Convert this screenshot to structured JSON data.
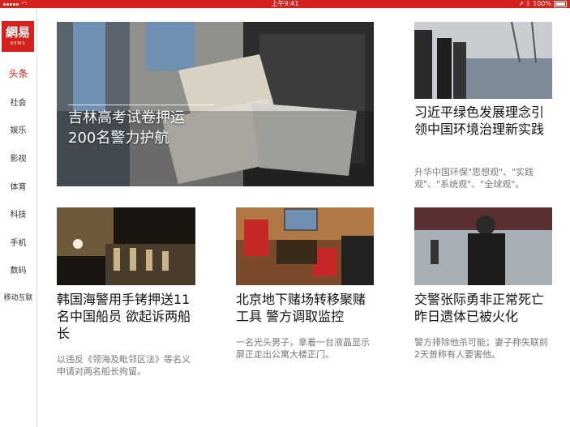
{
  "status": {
    "time": "上午9:41",
    "battery": "100%"
  },
  "logo": {
    "cn": "網易",
    "en": "NEWS"
  },
  "nav": [
    "头条",
    "社会",
    "娱乐",
    "影视",
    "体育",
    "科技",
    "手机",
    "数码",
    "移动互联"
  ],
  "hero": {
    "title_line1": "吉林高考试卷押运",
    "title_line2": "200名警力护航"
  },
  "articles": [
    {
      "title": "习近平绿色发展理念引领中国环境治理新实践",
      "summary": "升华中国环保\"思想观\"、\"实践观\"、\"系统观\"、\"全球观\"。"
    },
    {
      "title": "韩国海警用手铐押送11名中国船员 欲起诉两船长",
      "summary": "以违反《领海及毗邻区法》等名义申请对两名船长拘留。"
    },
    {
      "title": "北京地下赌场转移聚赌工具 警方调取监控",
      "summary": "一名光头男子，拿着一台液晶显示屏正走出公寓大楼正门。"
    },
    {
      "title": "交警张际勇非正常死亡 昨日遗体已被火化",
      "summary": "警方排除他杀可能；妻子称失联前2天曾称有人要害他。"
    }
  ]
}
